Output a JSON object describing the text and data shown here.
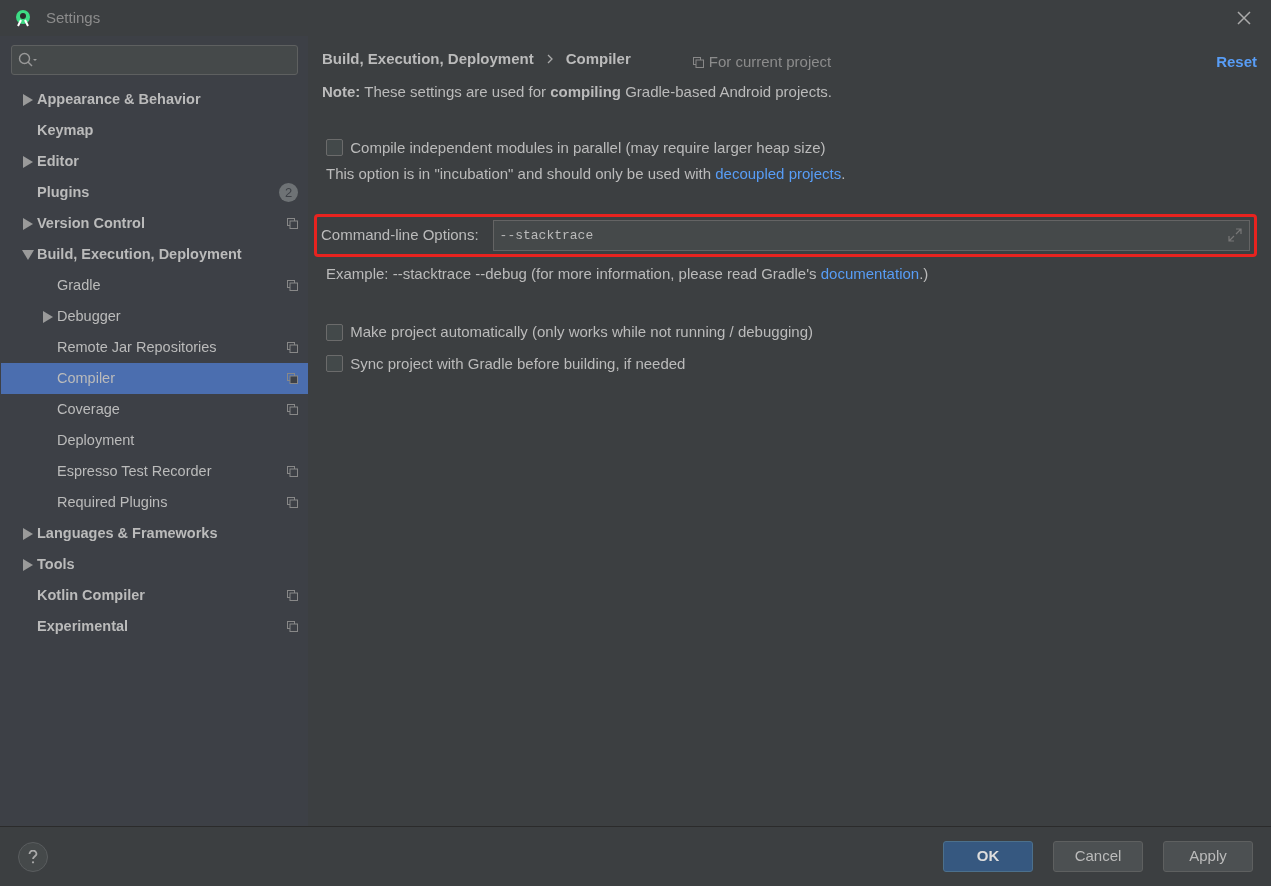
{
  "window": {
    "title": "Settings"
  },
  "tree": [
    {
      "label": "Appearance & Behavior",
      "expanded": false,
      "selected": false
    },
    {
      "label": "Keymap",
      "selected": false
    },
    {
      "label": "Editor",
      "expanded": false,
      "selected": false
    },
    {
      "label": "Plugins",
      "selected": false,
      "badge": "2"
    },
    {
      "label": "Version Control",
      "expanded": false,
      "selected": false,
      "project_scope": true
    },
    {
      "label": "Build, Execution, Deployment",
      "expanded": true,
      "selected": false,
      "children": [
        {
          "label": "Gradle",
          "selected": false,
          "project_scope": true
        },
        {
          "label": "Debugger",
          "expanded": false,
          "selected": false
        },
        {
          "label": "Remote Jar Repositories",
          "selected": false,
          "project_scope": true
        },
        {
          "label": "Compiler",
          "selected": true,
          "project_scope": true
        },
        {
          "label": "Coverage",
          "selected": false,
          "project_scope": true
        },
        {
          "label": "Deployment",
          "selected": false
        },
        {
          "label": "Espresso Test Recorder",
          "selected": false,
          "project_scope": true
        },
        {
          "label": "Required Plugins",
          "selected": false,
          "project_scope": true
        }
      ]
    },
    {
      "label": "Languages & Frameworks",
      "expanded": false,
      "selected": false
    },
    {
      "label": "Tools",
      "expanded": false,
      "selected": false
    },
    {
      "label": "Kotlin Compiler",
      "selected": false,
      "project_scope": true
    },
    {
      "label": "Experimental",
      "selected": false,
      "project_scope": true
    }
  ],
  "breadcrumb": [
    "Build, Execution, Deployment",
    "Compiler"
  ],
  "scope_note": "For current project",
  "reset": "Reset",
  "note": "**Note:** These settings are used for **compiling** Gradle-based Android projects.",
  "parallel": {
    "label": "Compile independent modules in parallel (may require larger heap size)",
    "checked": false
  },
  "parallel_hint": {
    "text": "This option is in \"incubation\" and should only be used with ",
    "link": "decoupled projects",
    "after": "."
  },
  "command_line": {
    "label": "Command-line Options:",
    "value": "--stacktrace",
    "highlighted": true
  },
  "example": {
    "text": "Example: --stacktrace --debug (for more information, please read Gradle's ",
    "link": "documentation",
    "after": ".)"
  },
  "options": [
    {
      "label": "Make project automatically (only works while not running / debugging)",
      "checked": false
    },
    {
      "label": "Sync project with Gradle before building, if needed",
      "checked": false
    }
  ],
  "buttons": [
    {
      "label": "OK",
      "kind": "primary"
    },
    {
      "label": "Cancel",
      "kind": "plain"
    },
    {
      "label": "Apply",
      "kind": "plain"
    }
  ]
}
